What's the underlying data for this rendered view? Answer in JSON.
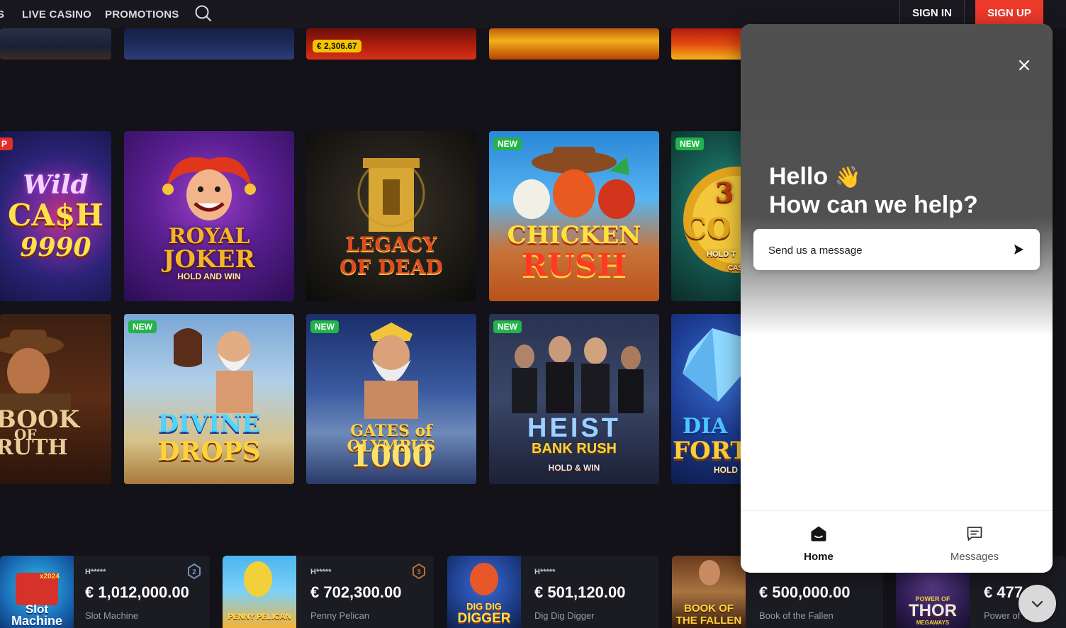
{
  "nav": {
    "cut_item": "S",
    "live_casino": "LIVE CASINO",
    "promotions": "PROMOTIONS",
    "sign_in": "SIGN IN",
    "sign_up": "SIGN UP",
    "search_icon": "search-icon"
  },
  "top_row": {
    "jackpot_value": "€ 2,306.67"
  },
  "games_row1": [
    {
      "title_a": "Wild",
      "title_b": "CA$H",
      "title_c": "9990",
      "badge": "P"
    },
    {
      "title_a": "ROYAL",
      "title_b": "JOKER",
      "sub": "HOLD AND WIN"
    },
    {
      "title_a": "LEGACY",
      "title_b": "OF DEAD"
    },
    {
      "title_a": "CHICKEN",
      "title_b": "RUSH",
      "badge": "NEW"
    },
    {
      "title_a": "3",
      "title_b": "CO",
      "sub": "HOLD T",
      "sub2": "CAS",
      "badge": "NEW"
    }
  ],
  "games_row2": [
    {
      "title_a": "BOOK",
      "title_b": "OF",
      "title_c": "RUTH"
    },
    {
      "title_a": "DIVINE",
      "title_b": "DROPS",
      "badge": "NEW"
    },
    {
      "title_a": "GATES of OLYMPUS",
      "title_b": "1000",
      "badge": "NEW"
    },
    {
      "title_a": "HEIST",
      "title_b": "BANK RUSH",
      "sub": "HOLD & WIN",
      "badge": "NEW"
    },
    {
      "title_a": "DIA",
      "title_b": "FORT",
      "sub": "HOLD"
    }
  ],
  "winners": [
    {
      "user": "H*****",
      "amount": "€ 1,012,000.00",
      "game": "Slot Machine",
      "thumb_a": "Slot",
      "thumb_b": "Machine",
      "thumb_c": "x2024",
      "rank": "2"
    },
    {
      "user": "H*****",
      "amount": "€ 702,300.00",
      "game": "Penny Pelican",
      "thumb_a": "PENNY PELICAN",
      "rank": "3"
    },
    {
      "user": "H*****",
      "amount": "€ 501,120.00",
      "game": "Dig Dig Digger",
      "thumb_a": "DIG DIG",
      "thumb_b": "DIGGER"
    },
    {
      "amount": "€ 500,000.00",
      "game": "Book of the Fallen",
      "thumb_a": "BOOK OF",
      "thumb_b": "THE FALLEN"
    },
    {
      "amount": "€ 477",
      "game": "Power of T",
      "thumb_a": "POWER OF",
      "thumb_b": "THOR",
      "thumb_c": "MEGAWAYS"
    }
  ],
  "chat": {
    "hello": "Hello",
    "wave": "👋",
    "help": "How can we help?",
    "send_message": "Send us a message",
    "tabs": [
      {
        "label": "Home",
        "icon": "home-icon",
        "active": true
      },
      {
        "label": "Messages",
        "icon": "messages-icon",
        "active": false
      }
    ]
  },
  "colors": {
    "brand_red": "#ee3a2b",
    "new_badge": "#23b34a",
    "jackpot_pill": "#f5c400",
    "chat_header": "#515151"
  }
}
